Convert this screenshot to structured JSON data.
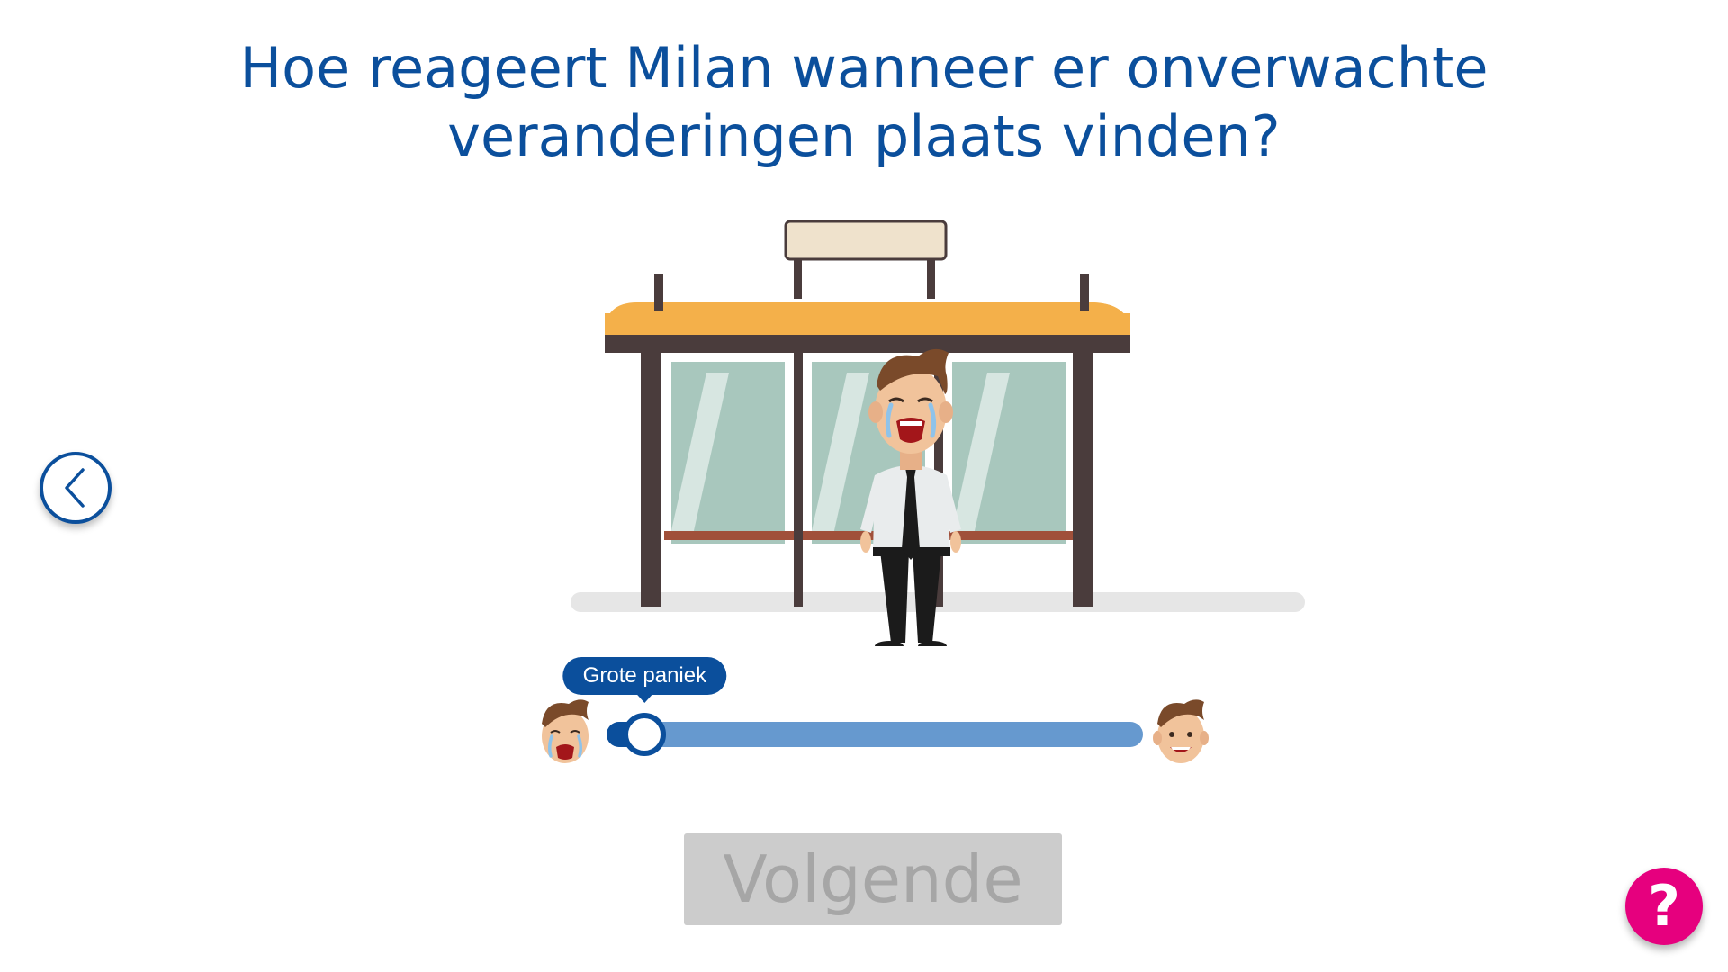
{
  "question": {
    "line1": "Hoe reageert Milan wanneer er onverwachte",
    "line2": "veranderingen plaats vinden?"
  },
  "navigation": {
    "back_icon": "chevron-left-icon"
  },
  "scene": {
    "sign_text": "",
    "character_mood": "crying"
  },
  "slider": {
    "value": 0.05,
    "value_label": "Grote paniek",
    "left_face": "crying-face-icon",
    "right_face": "smiling-face-icon"
  },
  "actions": {
    "next_label": "Volgende",
    "next_enabled": false,
    "help_label": "?"
  },
  "colors": {
    "primary": "#0b4f9c",
    "track": "#6699cf",
    "help": "#e6007e",
    "disabled_bg": "#cccccc",
    "disabled_text": "#a6a6a6"
  }
}
